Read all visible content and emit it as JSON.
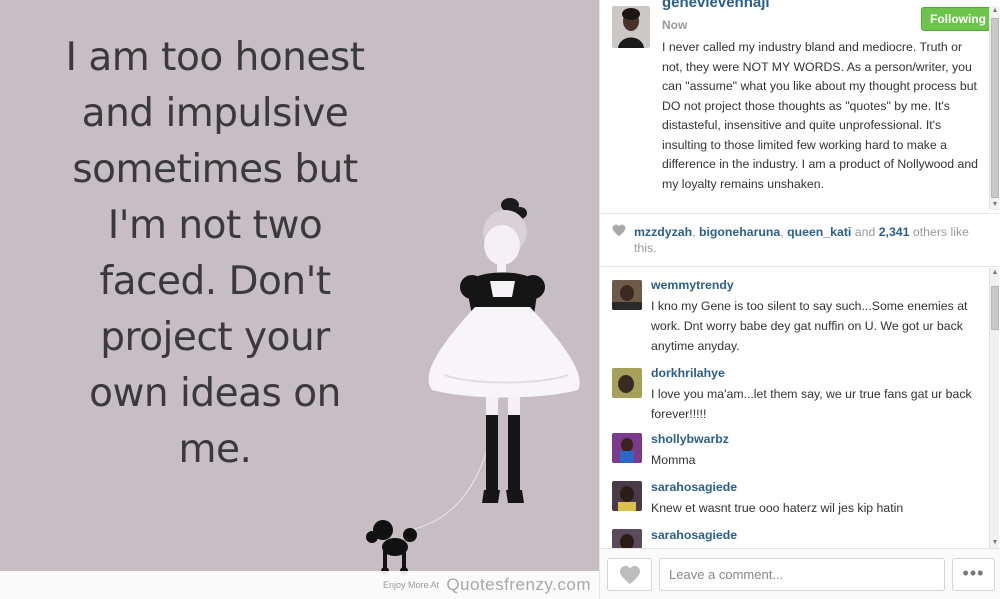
{
  "image": {
    "quote_text": "I am too honest\nand impulsive\nsometimes but\nI'm not two\nfaced. Don't\nproject your\nown ideas on\nme.",
    "watermark_small": "Enjoy More At",
    "watermark_main": "Quotesfrenzy.com"
  },
  "post": {
    "username": "genevievennaji",
    "timestamp": "Now",
    "follow_label": "Following",
    "caption": "I never called my industry bland and mediocre. Truth or not, they were NOT MY WORDS. As a person/writer, you can \"assume\" what you like about my thought process but DO not project those thoughts as \"quotes\" by me. It's distasteful, insensitive and quite unprofessional. It's insulting to those limited few working hard to make a difference in the industry. I am a product of Nollywood and my loyalty remains unshaken."
  },
  "likes": {
    "user1": "mzzdyzah",
    "sep1": ", ",
    "user2": "bigoneharuna",
    "sep2": ", ",
    "user3": "queen_kati",
    "and": " and ",
    "count": "2,341",
    "suffix": " others like this."
  },
  "comments": [
    {
      "user": "wemmytrendy",
      "text": "I kno my Gene is too silent to say such...Some enemies at work. Dnt worry babe dey gat nuffin on U. We got ur back anytime anyday."
    },
    {
      "user": "dorkhrilahye",
      "text": "I love you ma'am...let them say, we ur true fans gat ur back forever!!!!!"
    },
    {
      "user": "shollybwarbz",
      "text": "Momma"
    },
    {
      "user": "sarahosagiede",
      "text": "Knew et wasnt true ooo haterz wil jes kip hatin"
    },
    {
      "user": "sarahosagiede",
      "text": ""
    }
  ],
  "comment_bar": {
    "placeholder": "Leave a comment...",
    "more_label": "•••"
  },
  "colors": {
    "image_bg": "#c7bdc5",
    "link": "#2b5f8a",
    "follow_green": "#6cc44b"
  }
}
